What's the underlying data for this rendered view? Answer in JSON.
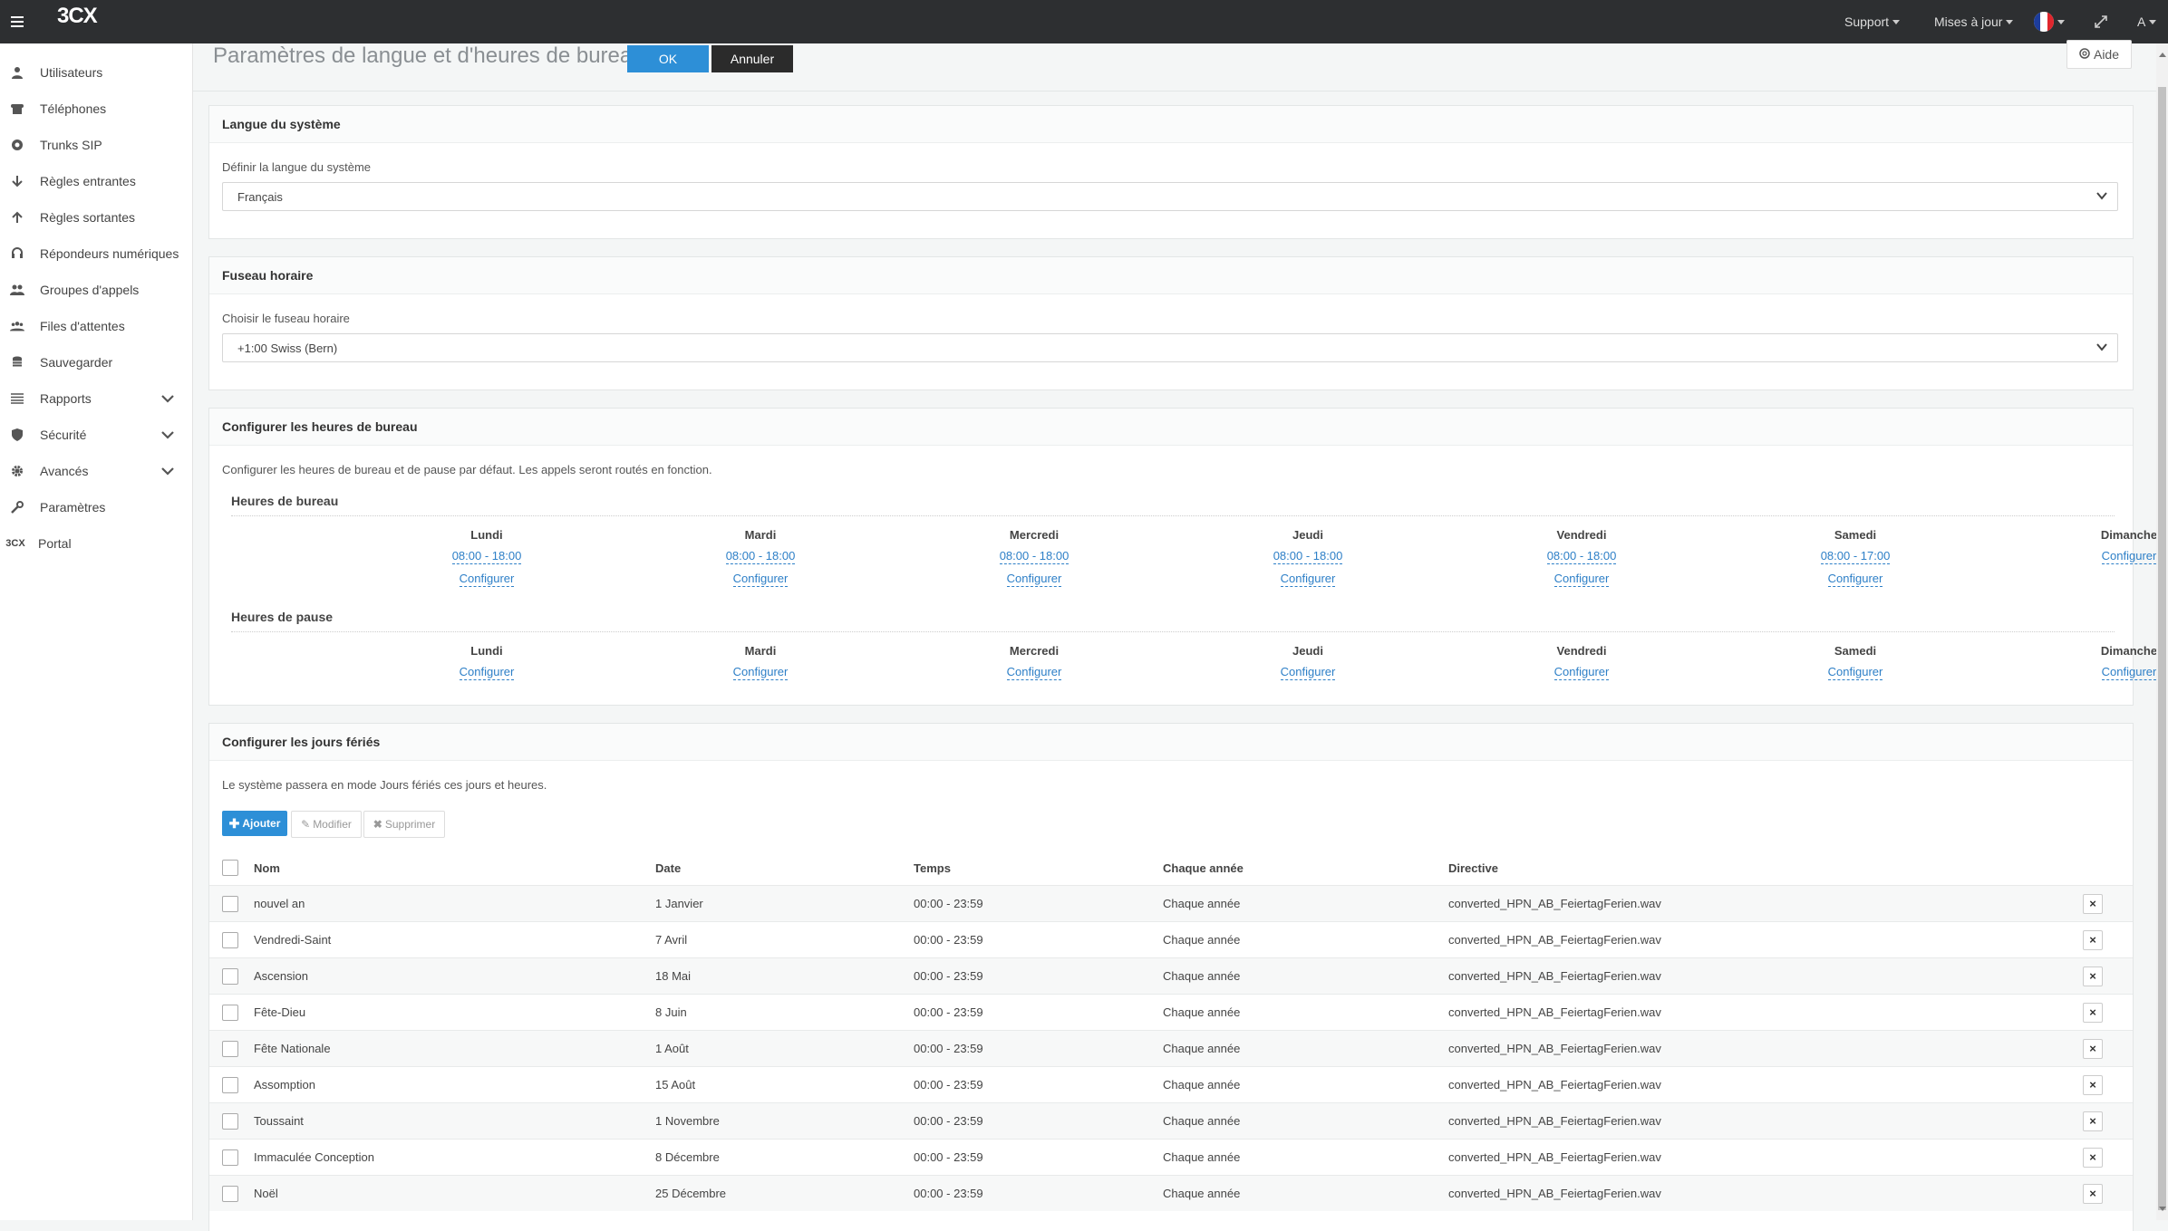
{
  "topbar": {
    "logo": "3CX",
    "support": "Support",
    "updates": "Mises à jour",
    "user": "A",
    "flag_colors": [
      "#1d3d9c",
      "#ffffff",
      "#e0262d"
    ]
  },
  "sidebar": {
    "items": [
      {
        "label": "Utilisateurs",
        "icon": "user-icon"
      },
      {
        "label": "Téléphones",
        "icon": "phone-icon"
      },
      {
        "label": "Trunks SIP",
        "icon": "globe-icon"
      },
      {
        "label": "Règles entrantes",
        "icon": "arrow-down-icon"
      },
      {
        "label": "Règles sortantes",
        "icon": "arrow-up-icon"
      },
      {
        "label": "Répondeurs numériques",
        "icon": "headset-icon"
      },
      {
        "label": "Groupes d'appels",
        "icon": "group-icon"
      },
      {
        "label": "Files d'attentes",
        "icon": "queue-icon"
      },
      {
        "label": "Sauvegarder",
        "icon": "database-icon"
      },
      {
        "label": "Rapports",
        "icon": "list-icon"
      },
      {
        "label": "Sécurité",
        "icon": "shield-icon"
      },
      {
        "label": "Avancés",
        "icon": "gear-icon"
      },
      {
        "label": "Paramètres",
        "icon": "wrench-icon"
      },
      {
        "label": "Portal",
        "icon": "3cx-logo-icon"
      }
    ]
  },
  "header": {
    "title": "Paramètres de langue et d'heures de bureau",
    "ok": "OK",
    "cancel": "Annuler",
    "help": "Aide"
  },
  "language": {
    "panel_title": "Langue du système",
    "label": "Définir la langue du système",
    "value": "Français"
  },
  "timezone": {
    "panel_title": "Fuseau horaire",
    "label": "Choisir le fuseau horaire",
    "value": "+1:00 Swiss (Bern)"
  },
  "office_hours": {
    "panel_title": "Configurer les heures de bureau",
    "description": "Configurer les heures de bureau et de pause par défaut. Les appels seront routés en fonction.",
    "hours_title": "Heures de bureau",
    "break_title": "Heures de pause",
    "configure": "Configurer",
    "days": [
      {
        "name": "Lundi",
        "hours": "08:00 - 18:00"
      },
      {
        "name": "Mardi",
        "hours": "08:00 - 18:00"
      },
      {
        "name": "Mercredi",
        "hours": "08:00 - 18:00"
      },
      {
        "name": "Jeudi",
        "hours": "08:00 - 18:00"
      },
      {
        "name": "Vendredi",
        "hours": "08:00 - 18:00"
      },
      {
        "name": "Samedi",
        "hours": "08:00 - 17:00"
      },
      {
        "name": "Dimanche",
        "hours": ""
      }
    ]
  },
  "holidays": {
    "panel_title": "Configurer les jours fériés",
    "description": "Le système passera en mode Jours fériés ces jours et heures.",
    "add": "Ajouter",
    "edit": "Modifier",
    "delete": "Supprimer",
    "columns": [
      "Nom",
      "Date",
      "Temps",
      "Chaque année",
      "Directive"
    ],
    "rows": [
      {
        "name": "nouvel an",
        "date": "1 Janvier",
        "time": "00:00 - 23:59",
        "yearly": "Chaque année",
        "prompt": "converted_HPN_AB_FeiertagFerien.wav"
      },
      {
        "name": "Vendredi-Saint",
        "date": "7 Avril",
        "time": "00:00 - 23:59",
        "yearly": "Chaque année",
        "prompt": "converted_HPN_AB_FeiertagFerien.wav"
      },
      {
        "name": "Ascension",
        "date": "18 Mai",
        "time": "00:00 - 23:59",
        "yearly": "Chaque année",
        "prompt": "converted_HPN_AB_FeiertagFerien.wav"
      },
      {
        "name": "Fête-Dieu",
        "date": "8 Juin",
        "time": "00:00 - 23:59",
        "yearly": "Chaque année",
        "prompt": "converted_HPN_AB_FeiertagFerien.wav"
      },
      {
        "name": "Fête Nationale",
        "date": "1 Août",
        "time": "00:00 - 23:59",
        "yearly": "Chaque année",
        "prompt": "converted_HPN_AB_FeiertagFerien.wav"
      },
      {
        "name": "Assomption",
        "date": "15 Août",
        "time": "00:00 - 23:59",
        "yearly": "Chaque année",
        "prompt": "converted_HPN_AB_FeiertagFerien.wav"
      },
      {
        "name": "Toussaint",
        "date": "1 Novembre",
        "time": "00:00 - 23:59",
        "yearly": "Chaque année",
        "prompt": "converted_HPN_AB_FeiertagFerien.wav"
      },
      {
        "name": "Immaculée Conception",
        "date": "8 Décembre",
        "time": "00:00 - 23:59",
        "yearly": "Chaque année",
        "prompt": "converted_HPN_AB_FeiertagFerien.wav"
      },
      {
        "name": "Noël",
        "date": "25 Décembre",
        "time": "00:00 - 23:59",
        "yearly": "Chaque année",
        "prompt": "converted_HPN_AB_FeiertagFerien.wav"
      }
    ]
  },
  "colors": {
    "accent": "#2d8fd7",
    "topbar": "#2d2f31",
    "link": "#2d7fc7"
  }
}
